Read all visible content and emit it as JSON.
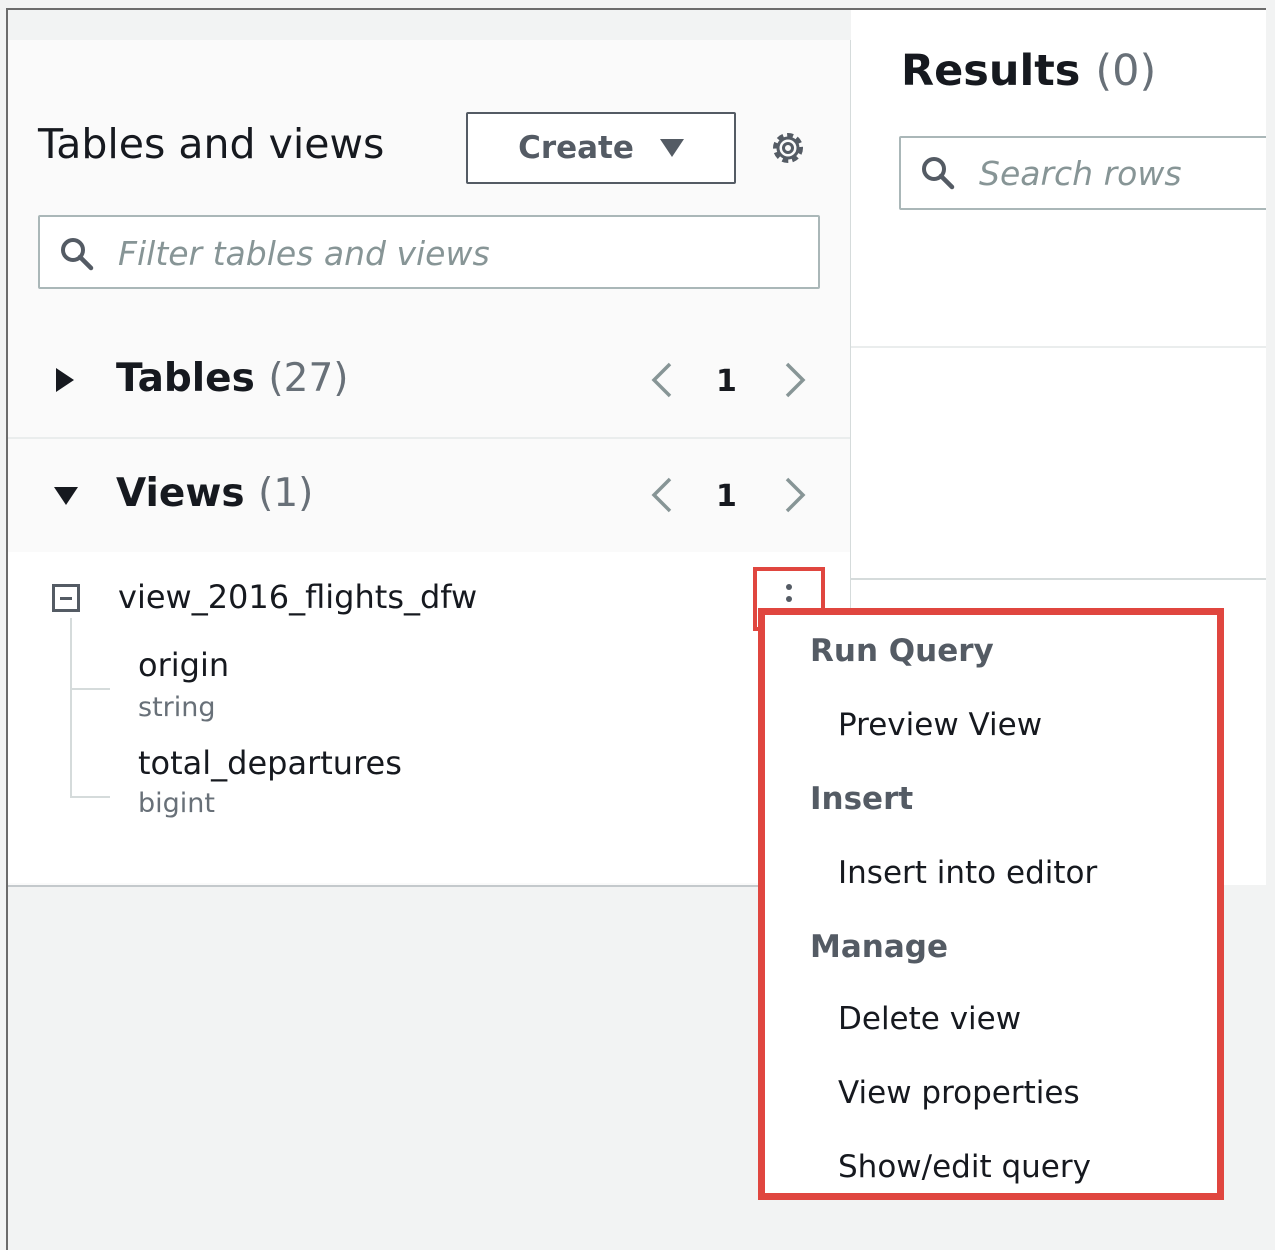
{
  "left_panel": {
    "title": "Tables and views",
    "create_label": "Create",
    "filter_placeholder": "Filter tables and views",
    "tables": {
      "label": "Tables",
      "count": "(27)",
      "page": "1"
    },
    "views": {
      "label": "Views",
      "count": "(1)",
      "page": "1"
    },
    "view": {
      "name": "view_2016_flights_dfw",
      "columns": [
        {
          "name": "origin",
          "type": "string"
        },
        {
          "name": "total_departures",
          "type": "bigint"
        }
      ]
    }
  },
  "results": {
    "title": "Results",
    "count": "(0)",
    "search_placeholder": "Search rows"
  },
  "context_menu": {
    "groups": [
      {
        "label": "Run Query",
        "items": [
          "Preview View"
        ]
      },
      {
        "label": "Insert",
        "items": [
          "Insert into editor"
        ]
      },
      {
        "label": "Manage",
        "items": [
          "Delete view",
          "View properties",
          "Show/edit query"
        ]
      }
    ]
  },
  "colors": {
    "highlight": "#e0463f",
    "panel_bg": "#fafafa",
    "text": "#16191f",
    "muted": "#687078"
  }
}
